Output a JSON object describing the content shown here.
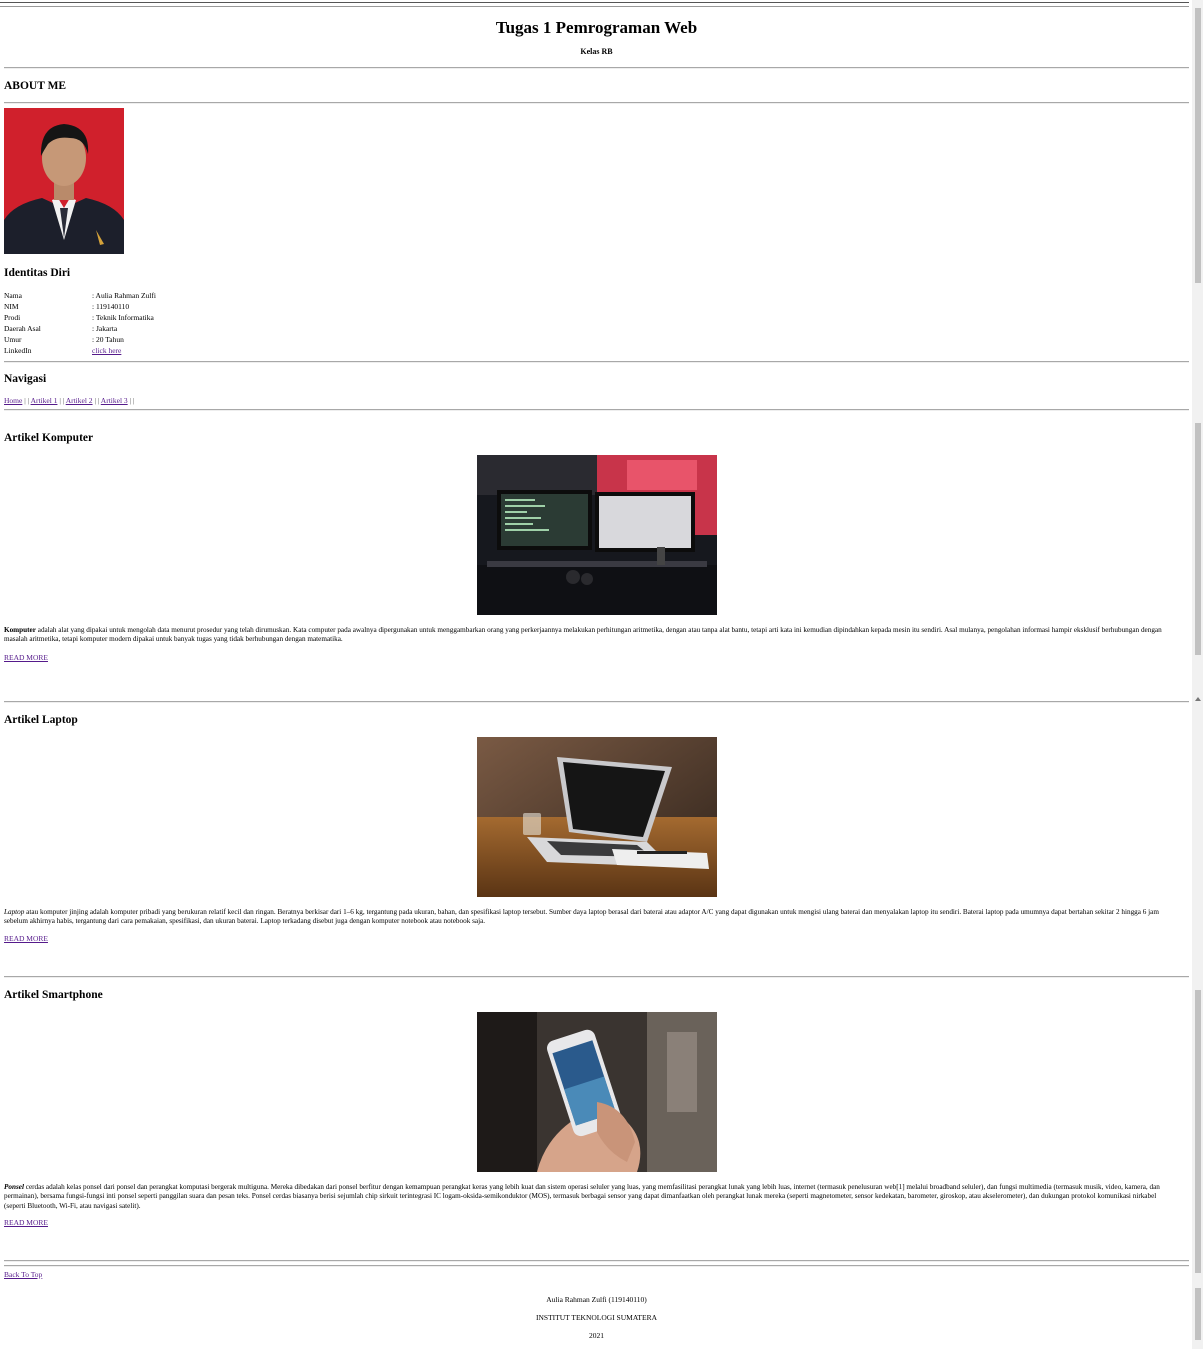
{
  "header": {
    "title": "Tugas 1 Pemrograman Web",
    "subtitle": "Kelas RB"
  },
  "about": {
    "heading": "ABOUT ME"
  },
  "identity": {
    "heading": "Identitas Diri",
    "rows": [
      {
        "key": "Nama",
        "value": ": Aulia Rahman Zulfi"
      },
      {
        "key": "NIM",
        "value": ": 119140110"
      },
      {
        "key": "Prodi",
        "value": ": Teknik Informatika"
      },
      {
        "key": "Daerah Asal",
        "value": ": Jakarta"
      },
      {
        "key": "Umur",
        "value": ": 20 Tahun"
      },
      {
        "key": "LinkedIn",
        "value": "click here"
      }
    ]
  },
  "nav": {
    "heading": "Navigasi",
    "links": [
      "Home",
      "Artikel 1",
      "Artikel 2",
      "Artikel 3"
    ],
    "separator": "| |"
  },
  "articles": [
    {
      "heading": "Artikel Komputer",
      "lead": "Komputer",
      "text": " adalah alat yang dipakai untuk mengolah data menurut prosedur yang telah dirumuskan. Kata computer pada awalnya dipergunakan untuk menggambarkan orang yang perkerjaannya melakukan perhitungan aritmetika, dengan atau tanpa alat bantu, tetapi arti kata ini kemudian dipindahkan kepada mesin itu sendiri. Asal mulanya, pengolahan informasi hampir eksklusif berhubungan dengan masalah aritmetika, tetapi komputer modern dipakai untuk banyak tugas yang tidak berhubungan dengan matematika.",
      "read_more": "READ MORE"
    },
    {
      "heading": "Artikel Laptop",
      "lead": "Laptop",
      "text": " atau komputer jinjing adalah komputer pribadi yang berukuran relatif kecil dan ringan. Beratnya berkisar dari 1–6 kg, tergantung pada ukuran, bahan, dan spesifikasi laptop tersebut. Sumber daya laptop berasal dari baterai atau adaptor A/C yang dapat digunakan untuk mengisi ulang baterai dan menyalakan laptop itu sendiri. Baterai laptop pada umumnya dapat bertahan sekitar 2 hingga 6 jam sebelum akhirnya habis, tergantung dari cara pemakaian, spesifikasi, dan ukuran baterai. Laptop terkadang disebut juga dengan komputer notebook atau notebook saja.",
      "read_more": "READ MORE"
    },
    {
      "heading": "Artikel Smartphone",
      "lead": "Ponsel",
      "text": " cerdas adalah kelas ponsel dari ponsel dan perangkat komputasi bergerak multiguna. Mereka dibedakan dari ponsel berfitur dengan kemampuan perangkat keras yang lebih kuat dan sistem operasi seluler yang luas, yang memfasilitasi perangkat lunak yang lebih luas, internet (termasuk penelusuran web[1] melalui broadband seluler), dan fungsi multimedia (termasuk musik, video, kamera, dan permainan), bersama fungsi-fungsi inti ponsel seperti panggilan suara dan pesan teks. Ponsel cerdas biasanya berisi sejumlah chip sirkuit terintegrasi IC logam-oksida-semikonduktor (MOS), termasuk berbagai sensor yang dapat dimanfaatkan oleh perangkat lunak mereka (seperti magnetometer, sensor kedekatan, barometer, giroskop, atau akselerometer), dan dukungan protokol komunikasi nirkabel (seperti Bluetooth, Wi-Fi, atau navigasi satelit).",
      "read_more": "READ MORE"
    }
  ],
  "back_to_top": "Back To Top",
  "footer": {
    "name": "Aulia Rahman Zulfi (119140110)",
    "institute": "INSTITUT TEKNOLOGI SUMATERA",
    "year": "2021"
  }
}
